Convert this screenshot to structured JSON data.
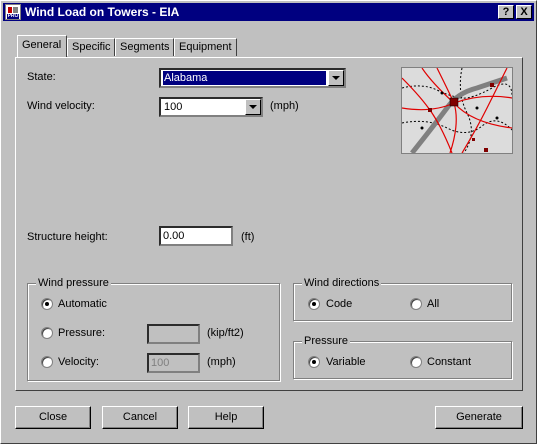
{
  "window": {
    "title": "Wind Load on Towers - EIA",
    "help_button": "?",
    "close_button": "X"
  },
  "tabs": [
    {
      "label": "General"
    },
    {
      "label": "Specific"
    },
    {
      "label": "Segments"
    },
    {
      "label": "Equipment"
    }
  ],
  "general": {
    "state_label": "State:",
    "state_value": "Alabama",
    "wind_velocity_label": "Wind velocity:",
    "wind_velocity_value": "100",
    "wind_velocity_unit": "(mph)",
    "structure_height_label": "Structure height:",
    "structure_height_value": "0.00",
    "structure_height_unit": "(ft)"
  },
  "wind_pressure": {
    "title": "Wind pressure",
    "automatic_label": "Automatic",
    "pressure_label": "Pressure:",
    "pressure_value": "",
    "pressure_unit": "(kip/ft2)",
    "velocity_label": "Velocity:",
    "velocity_value": "100",
    "velocity_unit": "(mph)",
    "selected": "Automatic"
  },
  "wind_directions": {
    "title": "Wind directions",
    "code_label": "Code",
    "all_label": "All",
    "selected": "Code"
  },
  "pressure": {
    "title": "Pressure",
    "variable_label": "Variable",
    "constant_label": "Constant",
    "selected": "Variable"
  },
  "buttons": {
    "close": "Close",
    "cancel": "Cancel",
    "help": "Help",
    "generate": "Generate"
  },
  "icons": {
    "app": "app-logo-icon",
    "map": "wind-map-thumbnail"
  }
}
